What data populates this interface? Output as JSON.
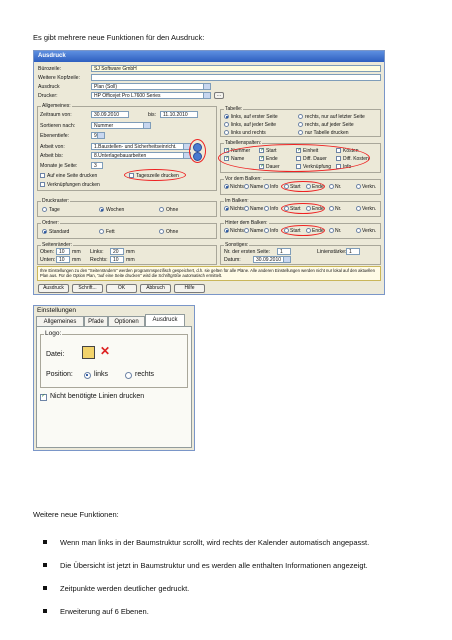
{
  "intro": "Es gibt mehrere neue Funktionen für den Ausdruck:",
  "ausdruck": {
    "title": "Ausdruck",
    "buero_label": "Bürozeile:",
    "buero_value": "SJ Software GmbH",
    "kopf_label": "Weitere Kopfzeile:",
    "ausdruck_label": "Ausdruck",
    "ausdruck_value": "Plan (Soll)",
    "drucker_label": "Drucker:",
    "drucker_value": "HP Officejet Pro L7600 Series",
    "allgemeines": "Allgemeines:",
    "zeitraum_label": "Zeitraum von:",
    "von": "30.09.2010",
    "bis_label": "bis:",
    "bis": "11.10.2010",
    "sort_label": "Sortieren nach:",
    "sort_value": "Nummer",
    "ebene_label": "Ebenentiefe:",
    "ebene_value": "9",
    "arbeit_von_label": "Arbeit von:",
    "arbeit_von": "1.Baustellen- und Sicherheitseinricht.",
    "arbeit_bis_label": "Arbeit bis:",
    "arbeit_bis": "8.Unterlagebauarbeiten",
    "monate_label": "Monate je Seite:",
    "monate": "3",
    "eine_seite": "Auf eine Seite drucken",
    "tageszeile": "Tageszeile drucken",
    "verknuepfungen": "Verknüpfungen drucken",
    "tabelle": "Tabelle:",
    "tab_opts": [
      "links, auf erster Seite",
      "rechts, nur auf letzter Seite",
      "links, auf jeder Seite",
      "rechts, auf jeder Seite",
      "links und rechts",
      "nur Tabelle drucken"
    ],
    "tabellenspalten": "Tabellenspalten:",
    "spalten": [
      "Nummer",
      "Start",
      "Einheit",
      "Kosten",
      "Name",
      "Ende",
      "Diff. Dauer",
      "Diff. Kosten",
      "Dauer",
      "Verknüpfung",
      "Info"
    ],
    "vor_balken": "Vor dem Balken:",
    "im_balken": "Im Balken:",
    "hinter_balken": "Hinter dem Balken:",
    "balken_opts": [
      "Nichts",
      "Name",
      "Info",
      "Start",
      "Ende",
      "Nr.",
      "Verkn."
    ],
    "druckraster": "Druckraster:",
    "raster_opts": [
      "Tage",
      "Wochen",
      "Ohne"
    ],
    "ordner": "Ordner:",
    "ordner_opts": [
      "Standard",
      "Fett",
      "Ohne"
    ],
    "seitenraender": "Seitenränder:",
    "oben_label": "Oben:",
    "oben": "10",
    "links_label": "Links:",
    "links": "20",
    "unten_label": "Unten:",
    "unten": "10",
    "rechts_label": "Rechts:",
    "rechts": "10",
    "mm": "mm",
    "sonstiges": "Sonstiges:",
    "erste_seite_label": "Nr. der ersten Seite:",
    "erste_seite": "1",
    "linienstaerke_label": "Linienstärke:",
    "linienstaerke": "1",
    "datum_label": "Datum:",
    "datum": "30.09.2010",
    "info": "Ihre Einstellungen zu den \"Seitenrändern\" werden programmspezifisch gespeichert, d.h. sie gelten für alle Pläne. Alle anderen Einstellungen werden nicht nur lokal auf den aktuellen Plan aus. Für die Option Plan, \"auf eine Seite drucken\" wird die Schriftgröße automatisch ermittelt.",
    "buttons": [
      "Ausdruck",
      "Schrift...",
      "OK",
      "Abbruch",
      "Hilfe"
    ]
  },
  "einstellungen": {
    "title": "Einstellungen",
    "tabs": [
      "Allgemeines",
      "Pfade",
      "Optionen",
      "Ausdruck"
    ],
    "logo": "Logo:",
    "datei": "Datei:",
    "position": "Position:",
    "links": "links",
    "rechts": "rechts",
    "nicht_benoetigte": "Nicht benötigte Linien drucken"
  },
  "weitere": "Weitere neue Funktionen:",
  "bullets": [
    "Wenn man links in der Baumstruktur scrollt, wird rechts der Kalender automatisch angepasst.",
    "Die Übersicht ist jetzt in Baumstruktur und es werden alle enthalten Informationen angezeigt.",
    "Zeitpunkte werden deutlicher gedruckt.",
    "Erweiterung auf 6 Ebenen."
  ],
  "colors": {
    "titlebar": "#2e5fbf",
    "dialog_bg": "#ece9d8",
    "highlight": "#e22222"
  }
}
